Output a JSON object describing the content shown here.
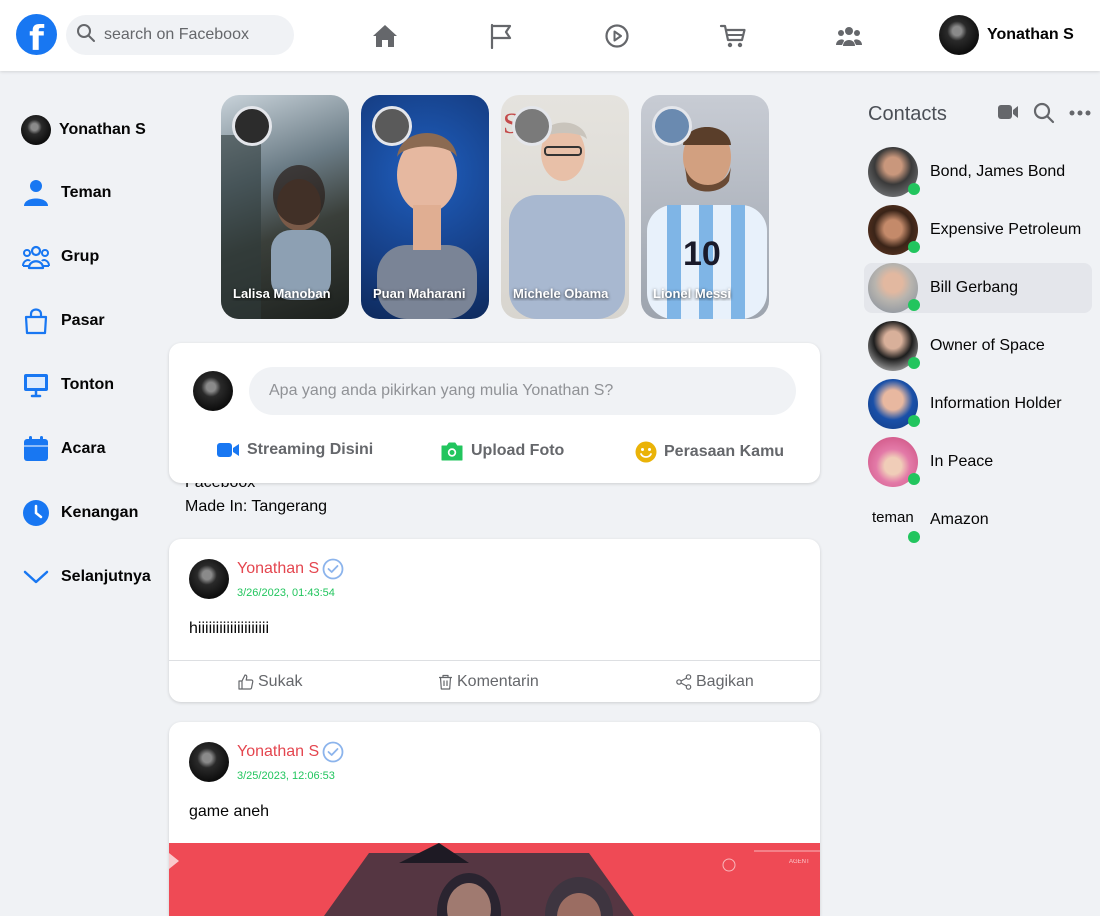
{
  "header": {
    "logo": "f",
    "search_placeholder": "search on Faceboox",
    "nav_icons": [
      "home-icon",
      "flag-icon",
      "play-icon",
      "cart-icon",
      "group-icon"
    ],
    "profile_name": "Yonathan S"
  },
  "sidebar": {
    "profile_name": "Yonathan S",
    "items": [
      {
        "label": "Teman",
        "icon": "user-icon"
      },
      {
        "label": "Grup",
        "icon": "users-icon"
      },
      {
        "label": "Pasar",
        "icon": "shopping-bag-icon"
      },
      {
        "label": "Tonton",
        "icon": "monitor-icon"
      },
      {
        "label": "Acara",
        "icon": "calendar-icon"
      },
      {
        "label": "Kenangan",
        "icon": "clock-icon"
      },
      {
        "label": "Selanjutnya",
        "icon": "chevron-down-icon"
      }
    ]
  },
  "stories": [
    {
      "name": "Lalisa Manoban"
    },
    {
      "name": "Puan Maharani"
    },
    {
      "name": "Michele Obama"
    },
    {
      "name": "Lionel Messi"
    }
  ],
  "composer": {
    "placeholder": "Apa yang anda pikirkan yang mulia Yonathan S?",
    "actions": [
      "Streaming Disini",
      "Upload Foto",
      "Perasaan Kamu"
    ]
  },
  "bio": {
    "line1": "Faceboox",
    "line2": "Made In: Tangerang"
  },
  "posts": [
    {
      "author": "Yonathan S",
      "time": "3/26/2023, 01:43:54",
      "text": "hiiiiiiiiiiiiiiiiiiii",
      "actions": [
        "Sukak",
        "Komentarin",
        "Bagikan"
      ]
    },
    {
      "author": "Yonathan S",
      "time": "3/25/2023, 12:06:53",
      "text": "game aneh"
    }
  ],
  "contacts": {
    "title": "Contacts",
    "list": [
      {
        "name": "Bond, James Bond"
      },
      {
        "name": "Expensive Petroleum"
      },
      {
        "name": "Bill Gerbang"
      },
      {
        "name": "Owner of Space"
      },
      {
        "name": "Information Holder"
      },
      {
        "name": "In Peace"
      },
      {
        "name": "Amazon",
        "alt": "teman"
      }
    ]
  },
  "colors": {
    "brand": "#1877f2",
    "author_name": "#e4464f",
    "timestamp": "#22c55e",
    "online": "#22c55e"
  }
}
